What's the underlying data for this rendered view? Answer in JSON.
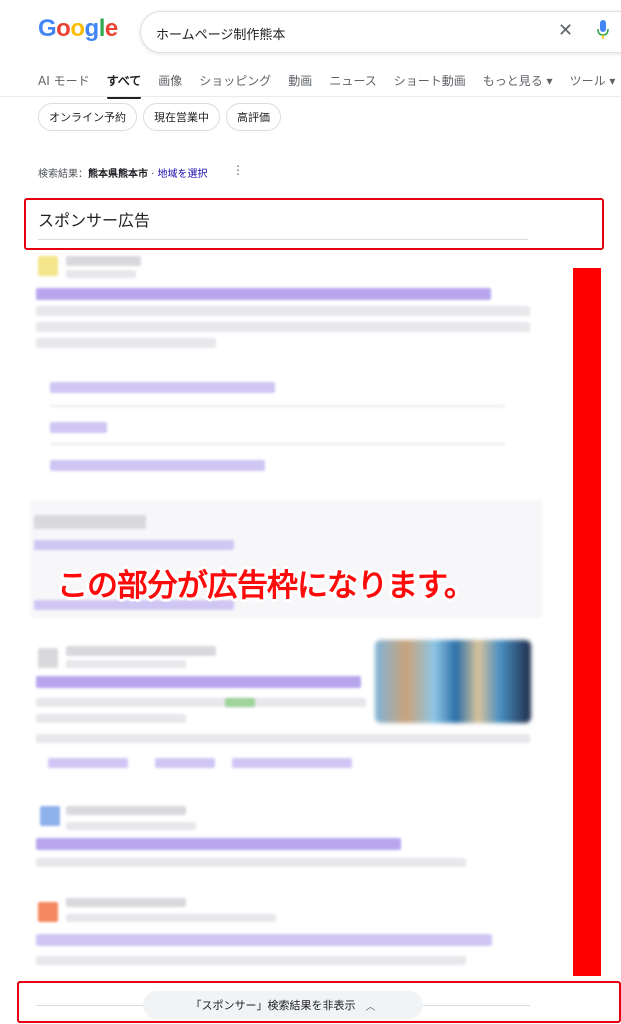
{
  "logo": {
    "letters": [
      "G",
      "o",
      "o",
      "g",
      "l",
      "e"
    ]
  },
  "colors": {
    "blue": "#4285F4",
    "red": "#EA4335",
    "yellow": "#FBBC05",
    "green": "#34A853",
    "annotation_red": "#FF0000"
  },
  "search": {
    "query": "ホームページ制作熊本"
  },
  "tabs": [
    "AI モード",
    "すべて",
    "画像",
    "ショッピング",
    "動画",
    "ニュース",
    "ショート動画",
    "もっと見る ▾",
    "ツール ▾"
  ],
  "chips": [
    "オンライン予約",
    "現在営業中",
    "高評価"
  ],
  "location": {
    "prefix": "検索結果：",
    "place": "熊本県熊本市",
    "link": "地域を選択",
    "sep": " · "
  },
  "sponsor": {
    "title": "スポンサー広告"
  },
  "annotation": {
    "text": "この部分が広告枠になります。"
  },
  "hide_button": {
    "label": "「スポンサー」検索結果を非表示",
    "icon": "chevron-up-icon"
  }
}
